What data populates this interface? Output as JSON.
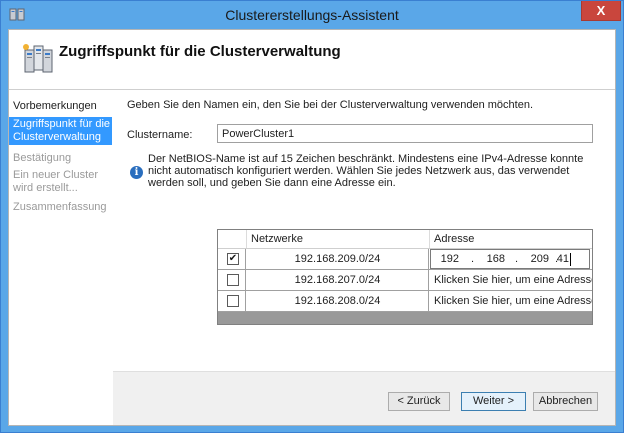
{
  "window": {
    "title": "Clustererstellungs-Assistent",
    "close_glyph": "X",
    "accent_color": "#5aa7e8"
  },
  "header": {
    "title": "Zugriffspunkt für die Clusterverwaltung",
    "icon": "cluster-servers-icon"
  },
  "nav": {
    "items": [
      {
        "label": "Vorbemerkungen",
        "state": "done"
      },
      {
        "label": "Zugriffspunkt für die Clusterverwaltung",
        "state": "active"
      },
      {
        "label": "Bestätigung",
        "state": "future"
      },
      {
        "label": "Ein neuer Cluster wird erstellt...",
        "state": "future"
      },
      {
        "label": "Zusammenfassung",
        "state": "future"
      }
    ]
  },
  "content": {
    "intro": "Geben Sie den Namen ein, den Sie bei der Clusterverwaltung verwenden möchten.",
    "cluster_name_label": "Clustername:",
    "cluster_name_value": "PowerCluster1",
    "info_glyph": "i",
    "info_text": "Der NetBIOS-Name ist auf 15 Zeichen beschränkt.  Mindestens eine IPv4-Adresse konnte nicht automatisch konfiguriert werden. Wählen Sie jedes Netzwerk aus, das verwendet werden soll, und geben Sie dann eine Adresse ein."
  },
  "grid": {
    "col_networks": "Netzwerke",
    "col_address": "Adresse",
    "check_glyph": "✔",
    "rows": [
      {
        "network": "192.168.209.0/24",
        "checked": true,
        "ip": [
          "192",
          "168",
          "209",
          "41"
        ]
      },
      {
        "network": "192.168.207.0/24",
        "checked": false,
        "address": "Klicken Sie hier, um eine Adresse e..."
      },
      {
        "network": "192.168.208.0/24",
        "checked": false,
        "address": "Klicken Sie hier, um eine Adresse e..."
      }
    ]
  },
  "footer": {
    "back_label": "< Zurück",
    "next_label": "Weiter >",
    "cancel_label": "Abbrechen"
  }
}
